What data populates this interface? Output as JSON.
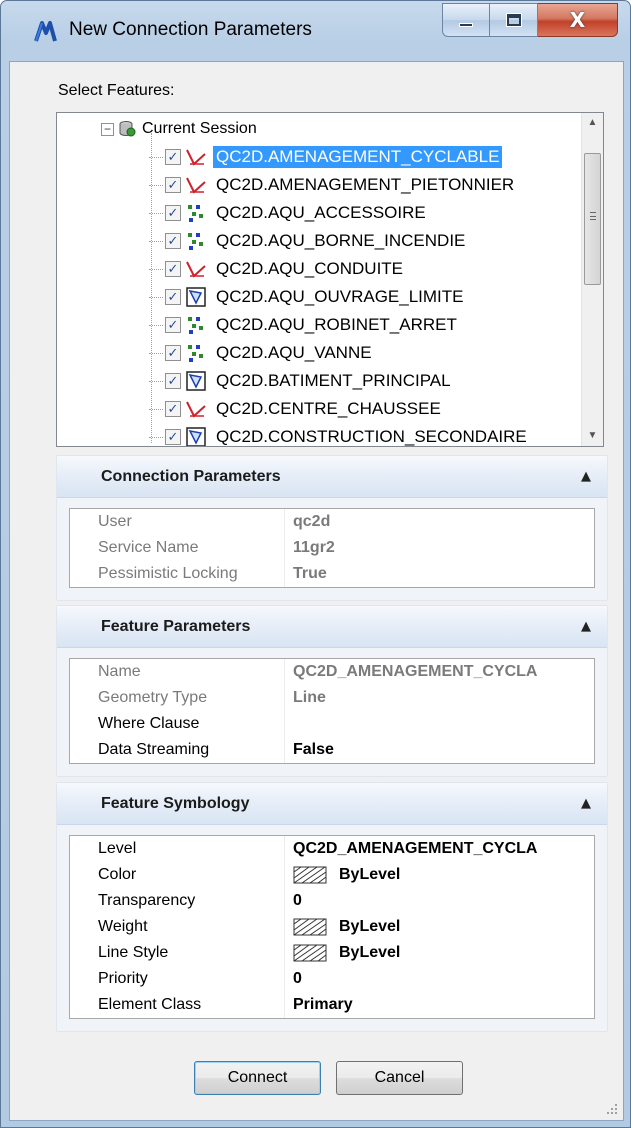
{
  "window": {
    "title": "New Connection Parameters",
    "close_glyph": "X"
  },
  "select_features_label": "Select Features:",
  "tree": {
    "root_label": "Current Session",
    "items": [
      {
        "label": "QC2D.AMENAGEMENT_CYCLABLE",
        "icon": "line-feature-icon",
        "checked": true,
        "selected": true
      },
      {
        "label": "QC2D.AMENAGEMENT_PIETONNIER",
        "icon": "line-feature-icon",
        "checked": true,
        "selected": false
      },
      {
        "label": "QC2D.AQU_ACCESSOIRE",
        "icon": "point-feature-icon",
        "checked": true,
        "selected": false
      },
      {
        "label": "QC2D.AQU_BORNE_INCENDIE",
        "icon": "point-feature-icon",
        "checked": true,
        "selected": false
      },
      {
        "label": "QC2D.AQU_CONDUITE",
        "icon": "line-feature-icon",
        "checked": true,
        "selected": false
      },
      {
        "label": "QC2D.AQU_OUVRAGE_LIMITE",
        "icon": "polygon-feature-icon",
        "checked": true,
        "selected": false
      },
      {
        "label": "QC2D.AQU_ROBINET_ARRET",
        "icon": "point-feature-icon",
        "checked": true,
        "selected": false
      },
      {
        "label": "QC2D.AQU_VANNE",
        "icon": "point-feature-icon",
        "checked": true,
        "selected": false
      },
      {
        "label": "QC2D.BATIMENT_PRINCIPAL",
        "icon": "polygon-feature-icon",
        "checked": true,
        "selected": false
      },
      {
        "label": "QC2D.CENTRE_CHAUSSEE",
        "icon": "line-feature-icon",
        "checked": true,
        "selected": false
      },
      {
        "label": "QC2D.CONSTRUCTION_SECONDAIRE",
        "icon": "polygon-feature-icon",
        "checked": true,
        "selected": false
      }
    ]
  },
  "connection_parameters": {
    "title": "Connection Parameters",
    "rows": [
      {
        "key": "User",
        "value": "qc2d"
      },
      {
        "key": "Service Name",
        "value": "11gr2"
      },
      {
        "key": "Pessimistic Locking",
        "value": "True"
      }
    ]
  },
  "feature_parameters": {
    "title": "Feature Parameters",
    "rows": [
      {
        "key": "Name",
        "value": "QC2D_AMENAGEMENT_CYCLA"
      },
      {
        "key": "Geometry Type",
        "value": "Line"
      },
      {
        "key": "Where Clause",
        "value": ""
      },
      {
        "key": "Data Streaming",
        "value": "False"
      }
    ]
  },
  "feature_symbology": {
    "title": "Feature Symbology",
    "rows": [
      {
        "key": "Level",
        "value": "QC2D_AMENAGEMENT_CYCLA"
      },
      {
        "key": "Color",
        "value": "ByLevel"
      },
      {
        "key": "Transparency",
        "value": "0"
      },
      {
        "key": "Weight",
        "value": "ByLevel"
      },
      {
        "key": "Line Style",
        "value": "ByLevel"
      },
      {
        "key": "Priority",
        "value": "0"
      },
      {
        "key": "Element Class",
        "value": "Primary"
      }
    ]
  },
  "buttons": {
    "connect": "Connect",
    "cancel": "Cancel"
  },
  "colors": {
    "selection": "#3399ff",
    "checkmark": "#2a4d96",
    "line_icon": "#d0202a",
    "point_icon_a": "#2c8a2c",
    "point_icon_b": "#2040c0"
  }
}
